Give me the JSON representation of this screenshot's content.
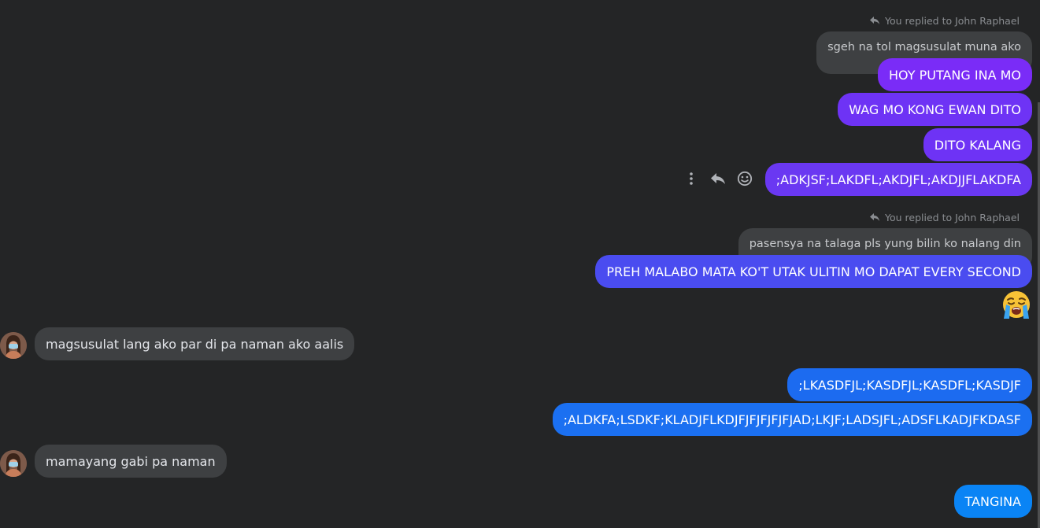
{
  "colors": {
    "background": "#242526",
    "incoming_bubble": "#3e4042",
    "quote_bubble": "#3e4042",
    "outgoing_gradient": [
      "#7a2cf7",
      "#6a38f2",
      "#4a4cf0",
      "#1c6bf0",
      "#0a84f5"
    ]
  },
  "groups": [
    {
      "reply_label": "You replied to John Raphael",
      "quoted_text": "sgeh na tol magsusulat muna ako",
      "messages": [
        "HOY PUTANG INA MO",
        "WAG MO KONG EWAN DITO",
        "DITO KALANG",
        ";ADKJSF;LAKDFL;AKDJFL;AKDJJFLAKDFA"
      ]
    },
    {
      "reply_label": "You replied to John Raphael",
      "quoted_text": "pasensya na talaga pls yung bilin ko nalang din",
      "messages": [
        "PREH MALABO MATA KO'T UTAK ULITIN MO DAPAT EVERY SECOND"
      ],
      "emoji": "loudly-crying-face-icon"
    }
  ],
  "incoming": [
    "magsusulat lang ako par di pa naman ako aalis",
    "mamayang gabi pa naman"
  ],
  "outgoing_later": [
    ";LKASDFJL;KASDFJL;KASDFL;KASDJF",
    ";ALDKFA;LSDKF;KLADJFLKDJFJFJFJFJFJAD;LKJF;LADSJFL;ADSFLKADJFKDASF",
    "TANGINA"
  ],
  "hover_actions": [
    "more-icon",
    "reply-icon",
    "react-icon"
  ]
}
